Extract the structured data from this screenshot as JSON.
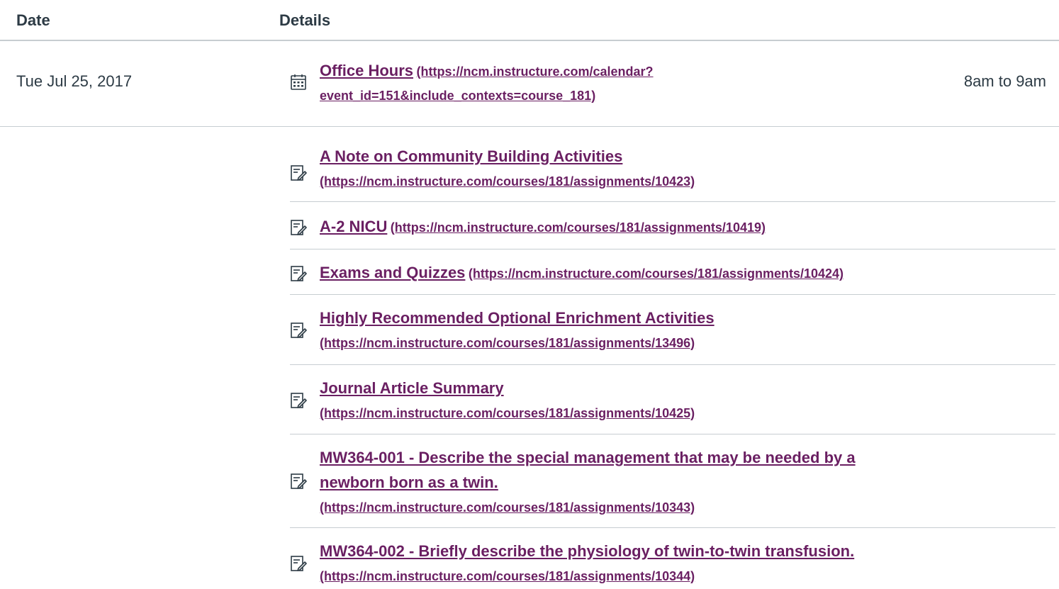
{
  "header": {
    "date_label": "Date",
    "details_label": "Details"
  },
  "event": {
    "date": "Tue Jul 25, 2017",
    "title": "Office Hours",
    "url_line1": "(https://ncm.instructure.com/calendar?",
    "url_line2": "event_id=151&include_contexts=course_181)",
    "time": "8am to 9am",
    "icon": "calendar-icon"
  },
  "assignments": [
    {
      "title": "A Note on Community Building Activities",
      "url": "(https://ncm.instructure.com/courses/181/assignments/10423)",
      "icon": "assignment-icon"
    },
    {
      "title": "A-2 NICU",
      "url": "(https://ncm.instructure.com/courses/181/assignments/10419)",
      "icon": "assignment-icon"
    },
    {
      "title": "Exams and Quizzes",
      "url": "(https://ncm.instructure.com/courses/181/assignments/10424)",
      "icon": "assignment-icon"
    },
    {
      "title": "Highly Recommended Optional Enrichment Activities",
      "url": "(https://ncm.instructure.com/courses/181/assignments/13496)",
      "icon": "assignment-icon"
    },
    {
      "title": "Journal Article Summary",
      "url": "(https://ncm.instructure.com/courses/181/assignments/10425)",
      "icon": "assignment-icon"
    },
    {
      "title_line1": "MW364-001 - Describe the special management that may be needed by a",
      "title_line2": "newborn born as a twin.",
      "url": "(https://ncm.instructure.com/courses/181/assignments/10343)",
      "icon": "assignment-icon"
    },
    {
      "title": "MW364-002 - Briefly describe the physiology of twin-to-twin transfusion.",
      "url": "(https://ncm.instructure.com/courses/181/assignments/10344)",
      "icon": "assignment-icon"
    }
  ],
  "colors": {
    "link": "#6a1f62",
    "text": "#2d3b45",
    "divider": "#c7cdd1"
  }
}
